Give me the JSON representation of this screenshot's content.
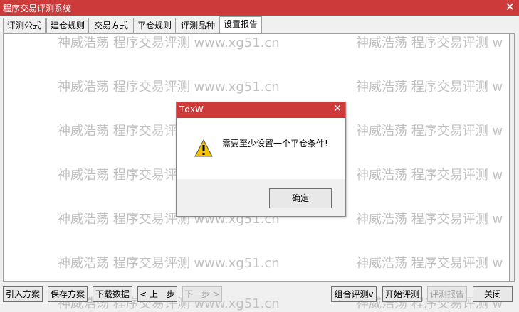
{
  "window": {
    "title": "程序交易评测系统",
    "close_glyph": "✕"
  },
  "tabs": [
    "评测公式",
    "建仓规则",
    "交易方式",
    "平仓规则",
    "评测品种",
    "设置报告"
  ],
  "watermark": {
    "text": "神威浩荡 程序交易评测 www.xg51.cn",
    "text_right": "神威浩荡 程序交易评测 w"
  },
  "buttons": {
    "import": "引入方案",
    "save": "保存方案",
    "download": "下载数据",
    "prev": "< 上一步",
    "next": "下一步 >",
    "combo": "组合评测v",
    "start": "开始评测",
    "report": "评测报告",
    "close": "关闭"
  },
  "dialog": {
    "title": "TdxW",
    "close_glyph": "✕",
    "message": "需要至少设置一个平仓条件!",
    "ok_label": "确定"
  }
}
